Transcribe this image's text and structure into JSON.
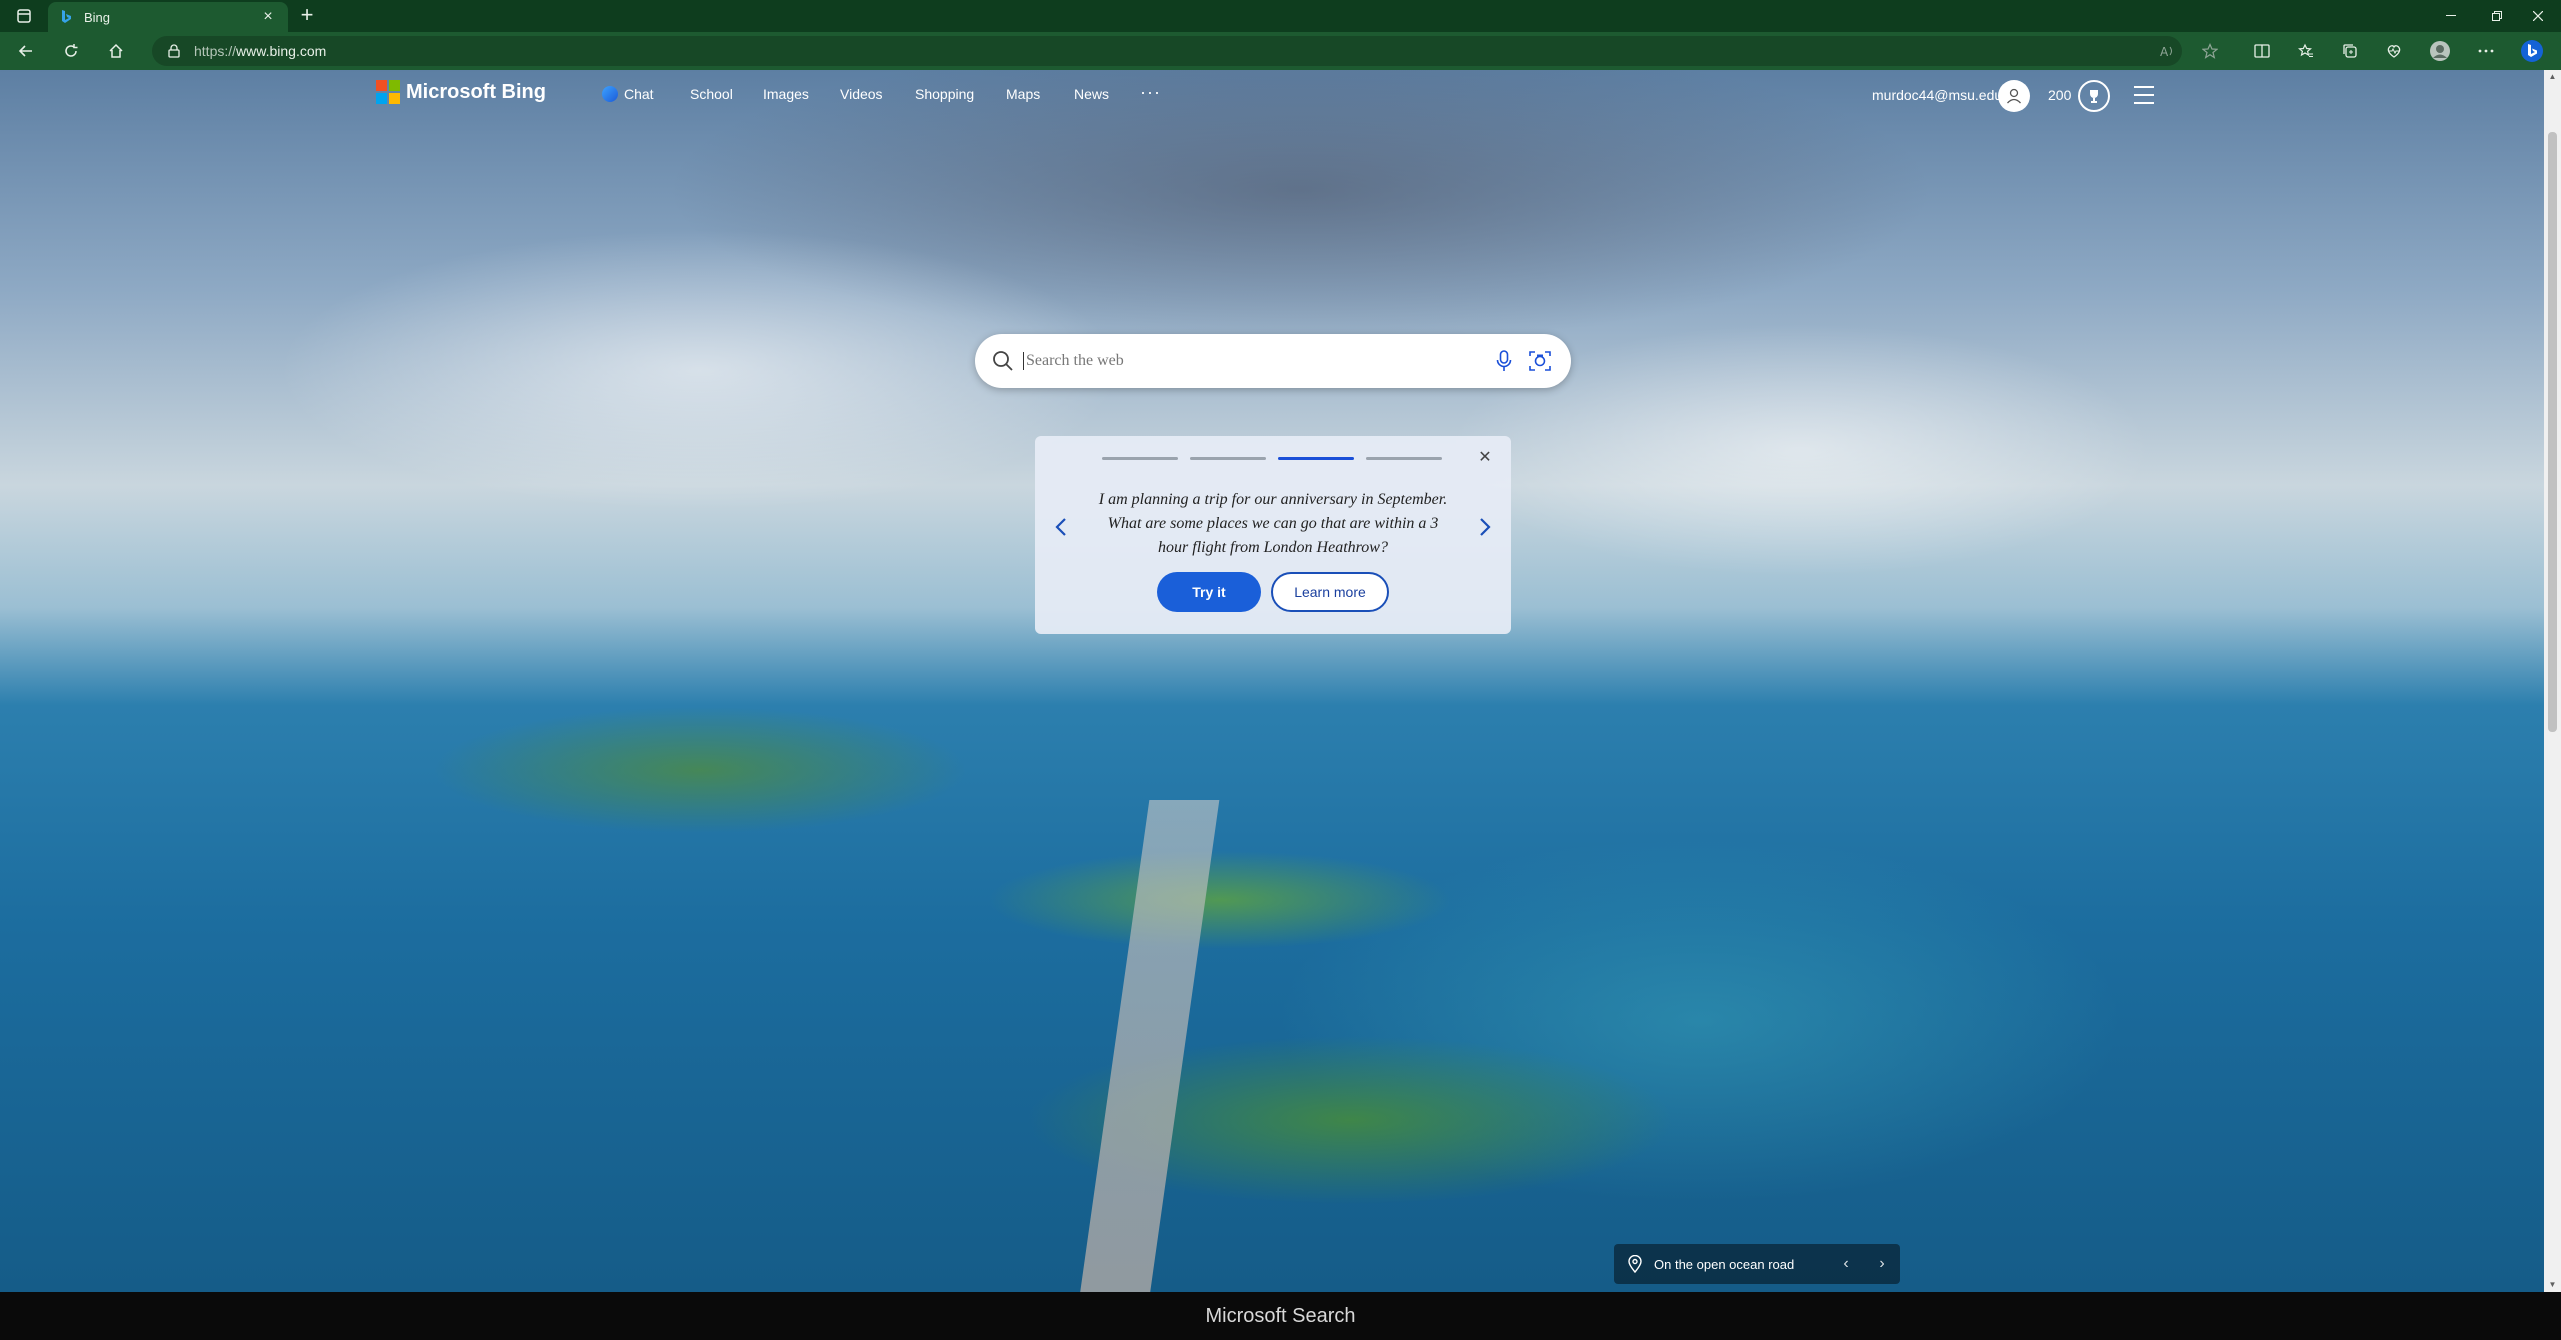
{
  "browser": {
    "tab_title": "Bing",
    "new_tab_icon": "plus-icon",
    "url_protocol": "https://",
    "url_host": "www.bing.com",
    "window_controls": [
      "minimize",
      "restore",
      "close"
    ]
  },
  "bing": {
    "logo_text": "Microsoft Bing",
    "nav": {
      "chat": "Chat",
      "school": "School",
      "images": "Images",
      "videos": "Videos",
      "shopping": "Shopping",
      "maps": "Maps",
      "news": "News",
      "more": "···"
    },
    "user_email": "murdoc44@msu.edu",
    "points": "200"
  },
  "search": {
    "placeholder": "Search the web",
    "value": ""
  },
  "promo": {
    "step_count": 4,
    "active_step": 3,
    "message": "I am planning a trip for our anniversary in September. What are some places we can go that are within a 3 hour flight from London Heathrow?",
    "try_label": "Try it",
    "learn_label": "Learn more"
  },
  "image_info": {
    "caption": "On the open ocean road"
  },
  "footer": {
    "text": "Microsoft Search"
  },
  "colors": {
    "chrome_dark": "#0e3d1e",
    "chrome": "#1d5a30",
    "accent_blue": "#1a5fd9"
  }
}
